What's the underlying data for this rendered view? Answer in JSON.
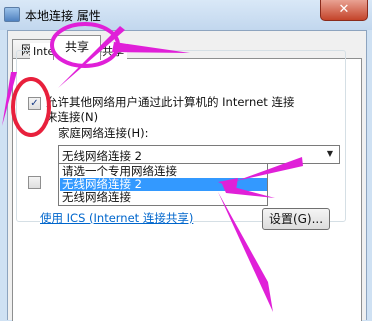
{
  "window": {
    "title": "本地连接 属性",
    "close_label": "✕"
  },
  "tabs": [
    {
      "label": "网络",
      "selected": false
    },
    {
      "label": "共享",
      "selected": true
    }
  ],
  "sharing": {
    "group_title": "Internet 连接共享",
    "allow_checkbox": {
      "checked": true,
      "mark": "✓",
      "line1": "允许其他网络用户通过此计算机的 Internet 连接",
      "line2": "来连接(N)"
    },
    "home_network_label": "家庭网络连接(H):",
    "home_network_select": {
      "value": "无线网络连接 2",
      "arrow": "▼",
      "options": [
        "请选一个专用网络连接",
        "无线网络连接 2",
        "无线网络连接"
      ],
      "highlighted_index": 1
    },
    "other_checkbox": {
      "checked": false
    },
    "ics_link": "使用 ICS (Internet 连接共享)",
    "settings_button": "设置(G)..."
  },
  "annotations": {
    "color": "#e020d8"
  }
}
